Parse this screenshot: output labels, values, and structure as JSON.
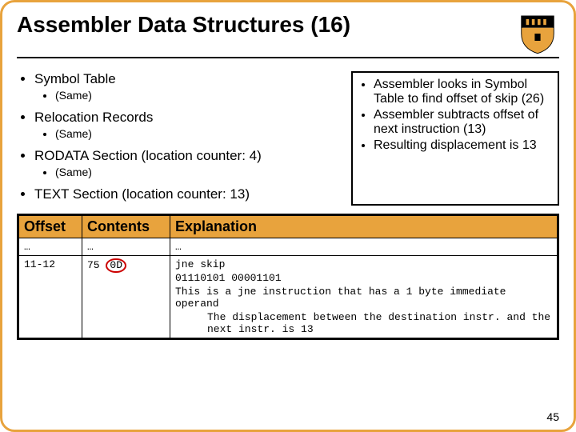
{
  "title": "Assembler Data Structures (16)",
  "left": {
    "i0": "Symbol Table",
    "i0s": "(Same)",
    "i1": "Relocation Records",
    "i1s": "(Same)",
    "i2": "RODATA Section (location counter: 4)",
    "i2s": "(Same)",
    "i3": "TEXT Section (location counter: 13)"
  },
  "callout": {
    "c0": "Assembler looks in Symbol Table to find offset of skip (26)",
    "c1": "Assembler subtracts offset of next instruction (13)",
    "c2": "Resulting displacement is 13"
  },
  "table": {
    "h0": "Offset",
    "h1": "Contents",
    "h2": "Explanation",
    "r0": {
      "offset": "…",
      "contents": "…",
      "explain": "…"
    },
    "r1": {
      "offset": "11-12",
      "contents_pre": "75 ",
      "contents_circ": "0D",
      "e0": "jne skip",
      "e1": "01110101 00001101",
      "e2": "This is a jne instruction that has a 1 byte immediate operand",
      "e3": "The displacement between the destination instr. and the next instr. is 13"
    }
  },
  "pagenum": "45"
}
